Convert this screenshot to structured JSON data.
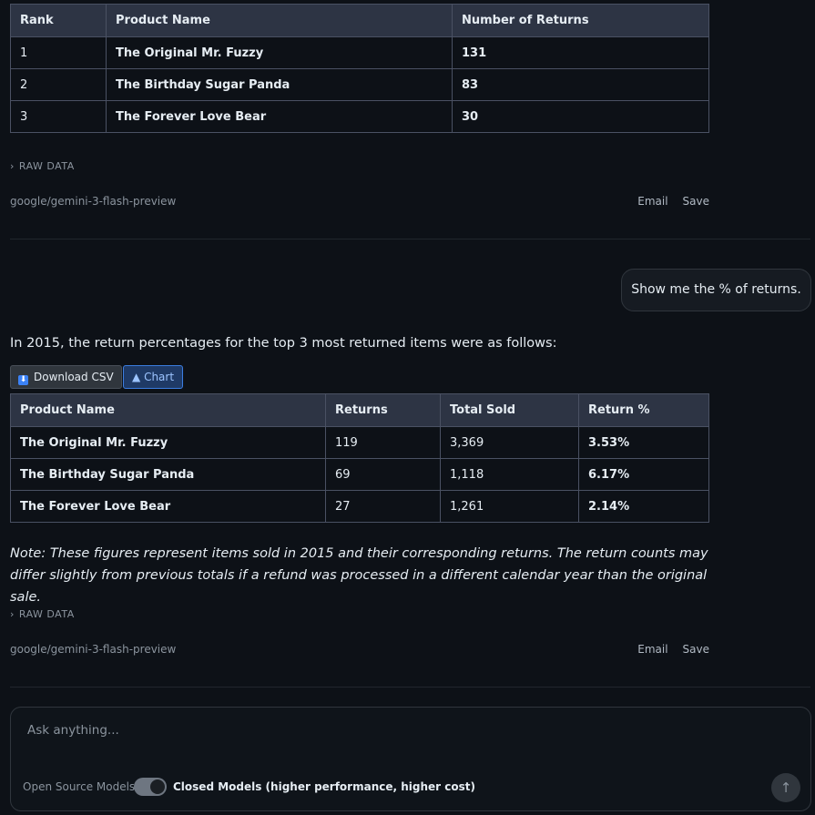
{
  "table1": {
    "headers": [
      "Rank",
      "Product Name",
      "Number of Returns"
    ],
    "rows": [
      [
        "1",
        "The Original Mr. Fuzzy",
        "131"
      ],
      [
        "2",
        "The Birthday Sugar Panda",
        "83"
      ],
      [
        "3",
        "The Forever Love Bear",
        "30"
      ]
    ]
  },
  "message1": {
    "raw_data_label": "RAW DATA",
    "model": "google/gemini-3-flash-preview",
    "email_label": "Email",
    "save_label": "Save"
  },
  "user_message": "Show me the % of returns.",
  "answer_intro": "In 2015, the return percentages for the top 3 most returned items were as follows:",
  "buttons": {
    "download_csv": "Download CSV",
    "chart": "Chart"
  },
  "table2": {
    "headers": [
      "Product Name",
      "Returns",
      "Total Sold",
      "Return %"
    ],
    "rows": [
      [
        "The Original Mr. Fuzzy",
        "119",
        "3,369",
        "3.53%"
      ],
      [
        "The Birthday Sugar Panda",
        "69",
        "1,118",
        "6.17%"
      ],
      [
        "The Forever Love Bear",
        "27",
        "1,261",
        "2.14%"
      ]
    ]
  },
  "note": "Note: These figures represent items sold in 2015 and their corresponding returns. The return counts may differ slightly from previous totals if a refund was processed in a different calendar year than the original sale.",
  "message2": {
    "raw_data_label": "RAW DATA",
    "model": "google/gemini-3-flash-preview",
    "email_label": "Email",
    "save_label": "Save"
  },
  "composer": {
    "placeholder": "Ask anything...",
    "open_source_label": "Open Source Models",
    "closed_label": "Closed Models (higher performance, higher cost)",
    "toggle_state": "closed"
  },
  "colors": {
    "background": "#0d1117",
    "table_header": "#2d3444",
    "accent": "#3b7de0"
  }
}
